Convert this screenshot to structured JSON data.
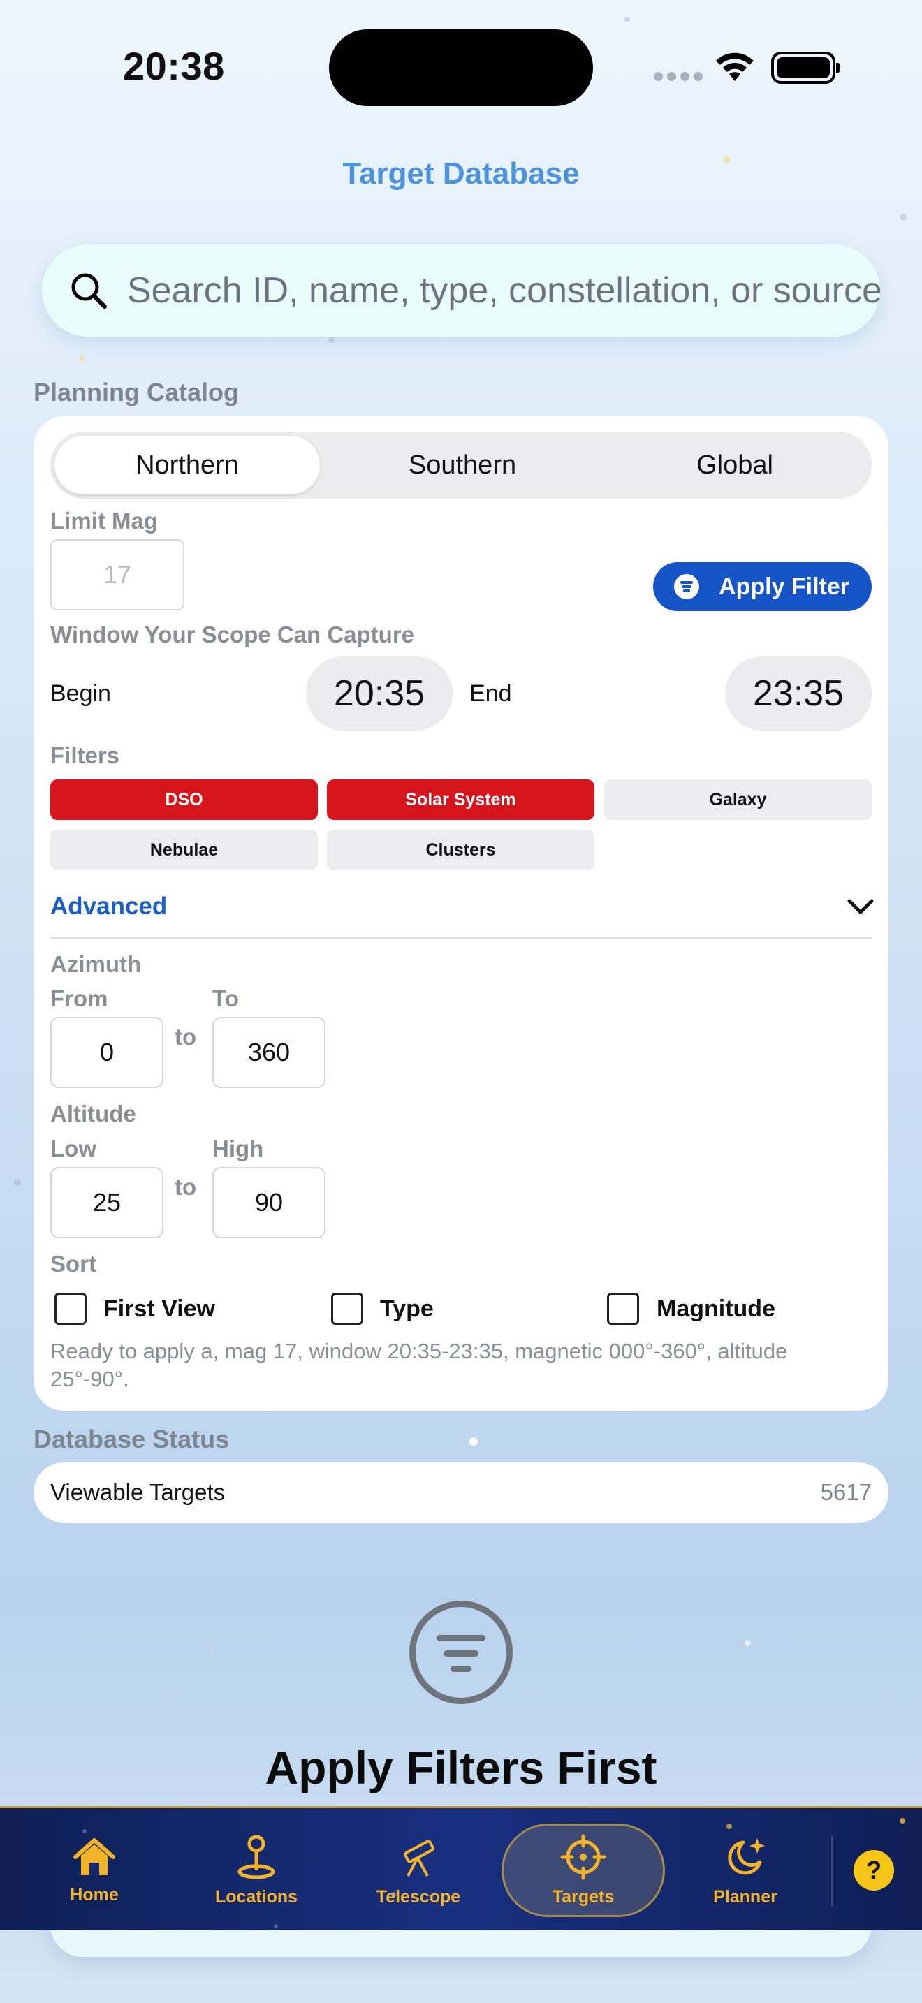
{
  "status_bar": {
    "time": "20:38"
  },
  "header": {
    "title": "Target Database"
  },
  "search": {
    "placeholder": "Search ID, name, type, constellation, or source"
  },
  "planning": {
    "section_label": "Planning Catalog",
    "segments": [
      "Northern",
      "Southern",
      "Global"
    ],
    "selected_segment": "Northern",
    "limit_mag_label": "Limit Mag",
    "limit_mag_value": "17",
    "apply_filter_label": "Apply Filter",
    "window_label": "Window Your Scope Can Capture",
    "begin_label": "Begin",
    "begin_time": "20:35",
    "end_label": "End",
    "end_time": "23:35",
    "filters_label": "Filters",
    "filters": [
      {
        "label": "DSO",
        "active": true
      },
      {
        "label": "Solar System",
        "active": true
      },
      {
        "label": "Galaxy",
        "active": false
      },
      {
        "label": "Nebulae",
        "active": false
      },
      {
        "label": "Clusters",
        "active": false
      }
    ],
    "advanced_label": "Advanced",
    "azimuth": {
      "label": "Azimuth",
      "from_label": "From",
      "to_label": "To",
      "from_value": "0",
      "to_value": "360",
      "sep": "to"
    },
    "altitude": {
      "label": "Altitude",
      "low_label": "Low",
      "high_label": "High",
      "low_value": "25",
      "high_value": "90",
      "sep": "to"
    },
    "sort": {
      "label": "Sort",
      "options": [
        "First View",
        "Type",
        "Magnitude"
      ]
    },
    "summary": "Ready to apply a, mag 17, window 20:35-23:35, magnetic 000°-360°, altitude 25°-90°."
  },
  "database_status": {
    "section_label": "Database Status",
    "viewable_label": "Viewable Targets",
    "viewable_count": "5617"
  },
  "empty_state": {
    "title": "Apply Filters First"
  },
  "tabbar": {
    "tabs": [
      {
        "label": "Home",
        "icon": "home-icon"
      },
      {
        "label": "Locations",
        "icon": "location-pin-icon"
      },
      {
        "label": "Telescope",
        "icon": "telescope-icon"
      },
      {
        "label": "Targets",
        "icon": "crosshair-icon"
      },
      {
        "label": "Planner",
        "icon": "moon-star-icon"
      }
    ],
    "active_tab": "Targets",
    "help": "?"
  },
  "colors": {
    "accent": "#1555c8",
    "chip_active": "#d6151c",
    "tab_gold": "#f3b328",
    "tab_bg": "#142770"
  }
}
